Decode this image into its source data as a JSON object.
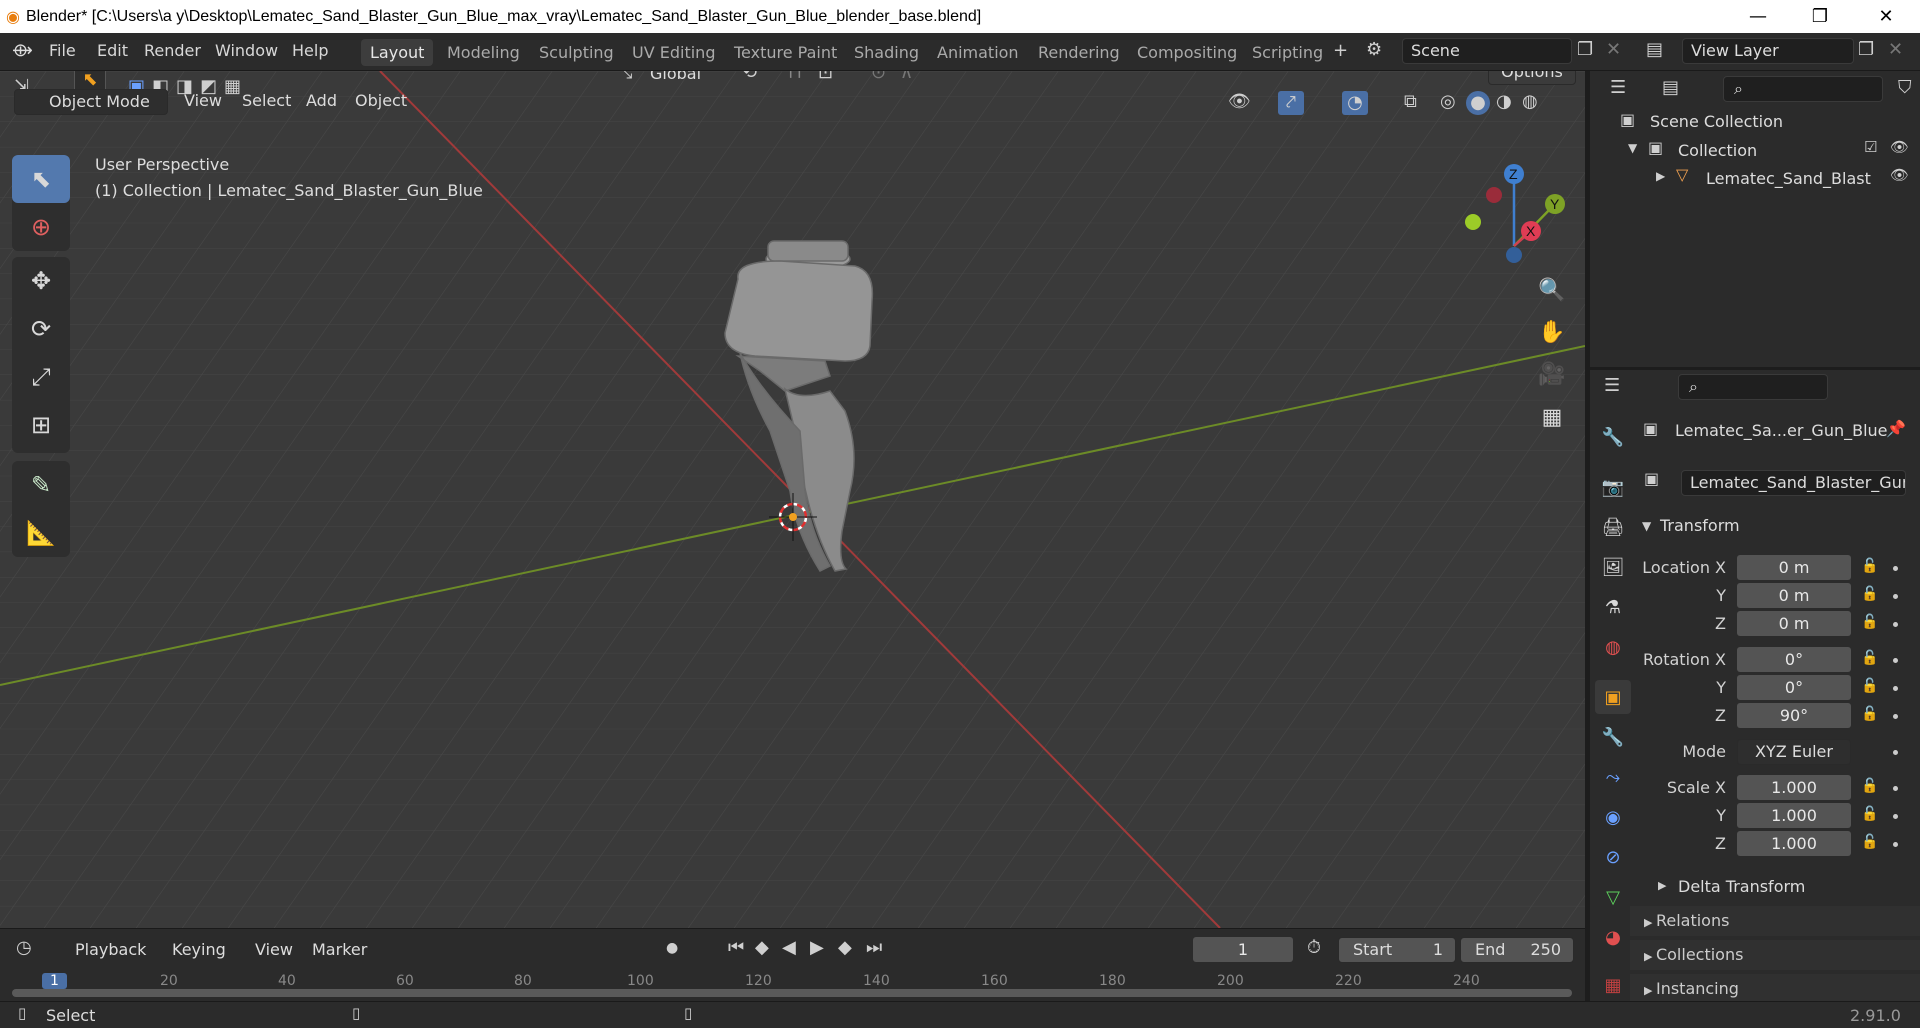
{
  "window": {
    "title": "Blender* [C:\\Users\\a y\\Desktop\\Lematec_Sand_Blaster_Gun_Blue_max_vray\\Lematec_Sand_Blaster_Gun_Blue_blender_base.blend]"
  },
  "menu": [
    "File",
    "Edit",
    "Render",
    "Window",
    "Help"
  ],
  "workspaces": [
    "Layout",
    "Modeling",
    "Sculpting",
    "UV Editing",
    "Texture Paint",
    "Shading",
    "Animation",
    "Rendering",
    "Compositing",
    "Scripting"
  ],
  "scene": {
    "name": "Scene",
    "view_layer": "View Layer"
  },
  "toolbar": {
    "orientation": "Global",
    "options": "Options"
  },
  "viewport_header": {
    "mode": "Object Mode",
    "items": [
      "View",
      "Select",
      "Add",
      "Object"
    ]
  },
  "viewport": {
    "perspective": "User Perspective",
    "collection": "(1) Collection | Lematec_Sand_Blaster_Gun_Blue"
  },
  "gizmo": {
    "x": "X",
    "y": "Y",
    "z": "Z"
  },
  "outliner": {
    "scene_collection": "Scene Collection",
    "collection": "Collection",
    "object": "Lematec_Sand_Blast"
  },
  "properties": {
    "object_name": "Lematec_Sa...er_Gun_Blue",
    "data_name": "Lematec_Sand_Blaster_Gun...",
    "transform_label": "Transform",
    "location_label": "Location X",
    "rotation_label": "Rotation X",
    "scale_label": "Scale X",
    "y_label": "Y",
    "z_label": "Z",
    "mode_label": "Mode",
    "location": [
      "0 m",
      "0 m",
      "0 m"
    ],
    "rotation": [
      "0°",
      "0°",
      "90°"
    ],
    "mode": "XYZ Euler",
    "scale": [
      "1.000",
      "1.000",
      "1.000"
    ],
    "sections": [
      "Delta Transform",
      "Relations",
      "Collections",
      "Instancing"
    ]
  },
  "timeline": {
    "menus": [
      "Playback",
      "Keying",
      "View",
      "Marker"
    ],
    "current_frame": "1",
    "start_label": "Start",
    "start": "1",
    "end_label": "End",
    "end": "250",
    "ruler": [
      "1",
      "20",
      "40",
      "60",
      "80",
      "100",
      "120",
      "140",
      "160",
      "180",
      "200",
      "220",
      "240"
    ]
  },
  "status": {
    "left": "Select",
    "version": "2.91.0"
  }
}
